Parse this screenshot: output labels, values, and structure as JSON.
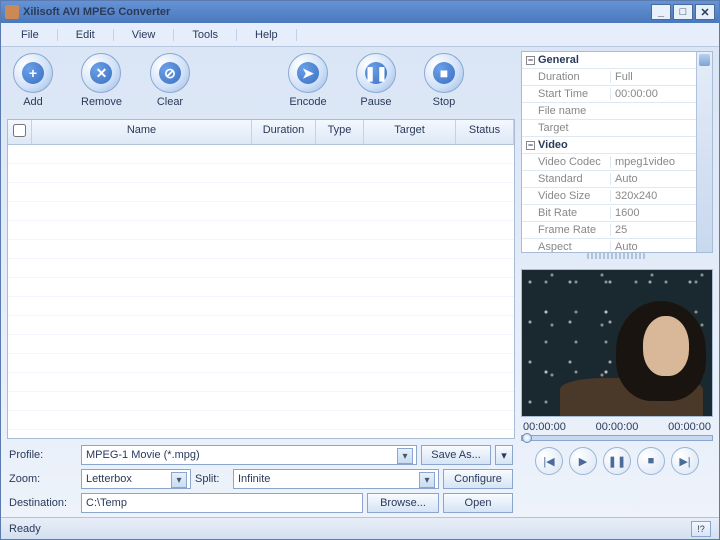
{
  "window": {
    "title": "Xilisoft AVI MPEG Converter"
  },
  "menu": [
    "File",
    "Edit",
    "View",
    "Tools",
    "Help"
  ],
  "toolbar": [
    {
      "label": "Add",
      "glyph": "+"
    },
    {
      "label": "Remove",
      "glyph": "✕"
    },
    {
      "label": "Clear",
      "glyph": "⊘"
    },
    {
      "label": "Encode",
      "glyph": "➤"
    },
    {
      "label": "Pause",
      "glyph": "❚❚"
    },
    {
      "label": "Stop",
      "glyph": "■"
    }
  ],
  "grid": {
    "cols": [
      "",
      "Name",
      "Duration",
      "Type",
      "Target",
      "Status"
    ]
  },
  "form": {
    "profile_label": "Profile:",
    "profile_value": "MPEG-1 Movie (*.mpg)",
    "saveas": "Save As...",
    "more": "▾",
    "zoom_label": "Zoom:",
    "zoom_value": "Letterbox",
    "split_label": "Split:",
    "split_value": "Infinite",
    "configure": "Configure",
    "dest_label": "Destination:",
    "dest_value": "C:\\Temp",
    "browse": "Browse...",
    "open": "Open"
  },
  "props": {
    "sections": [
      {
        "name": "General",
        "rows": [
          [
            "Duration",
            "Full"
          ],
          [
            "Start Time",
            "00:00:00"
          ],
          [
            "File name",
            ""
          ],
          [
            "Target",
            ""
          ]
        ]
      },
      {
        "name": "Video",
        "rows": [
          [
            "Video Codec",
            "mpeg1video"
          ],
          [
            "Standard",
            "Auto"
          ],
          [
            "Video Size",
            "320x240"
          ],
          [
            "Bit Rate",
            "1600"
          ],
          [
            "Frame Rate",
            "25"
          ],
          [
            "Aspect",
            "Auto"
          ]
        ]
      }
    ]
  },
  "timeline": [
    "00:00:00",
    "00:00:00",
    "00:00:00"
  ],
  "status": {
    "text": "Ready",
    "help": "!?"
  }
}
